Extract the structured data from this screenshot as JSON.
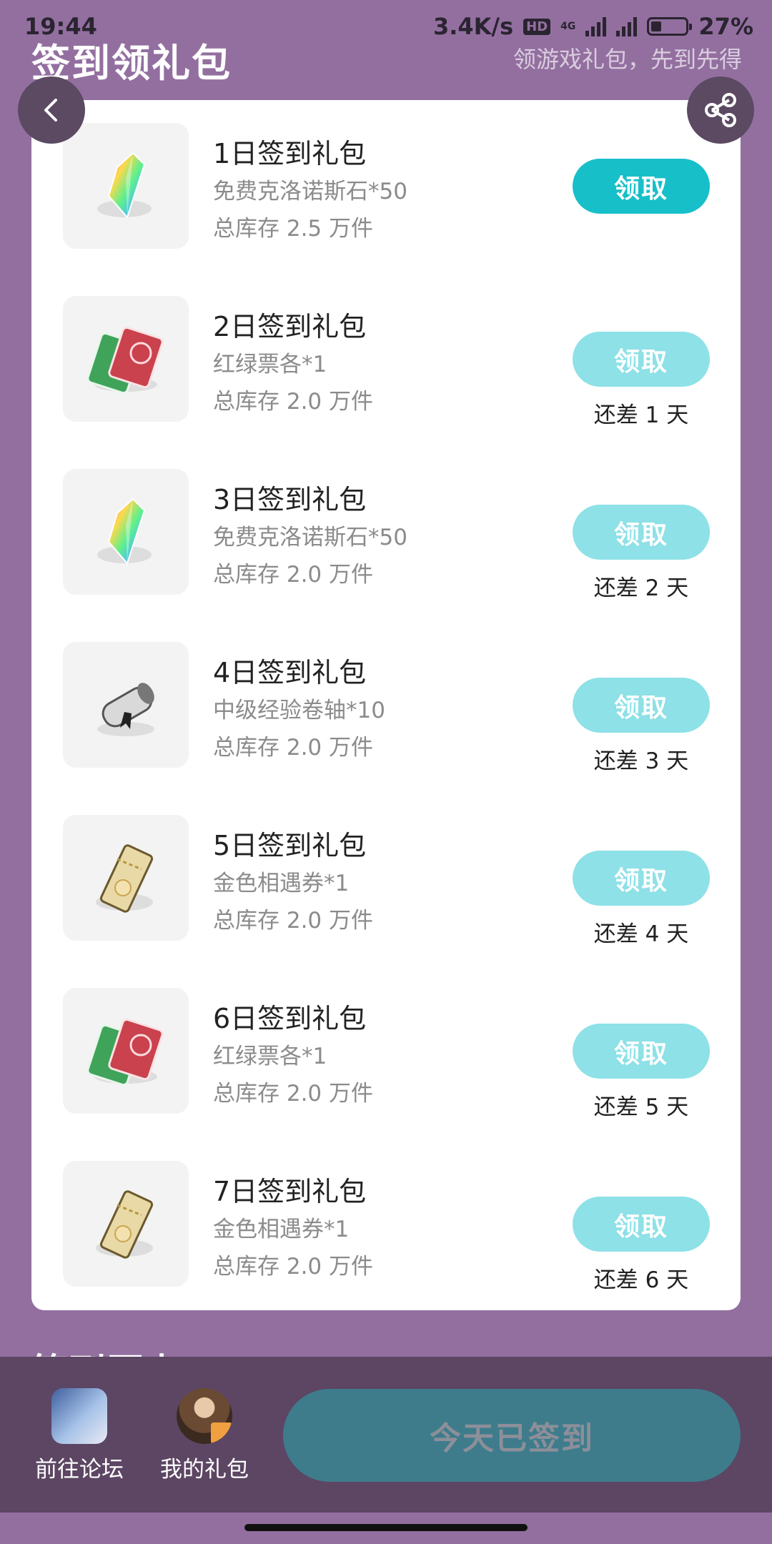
{
  "status_bar": {
    "time": "19:44",
    "net_speed": "3.4K/s",
    "hd": "HD",
    "network": "4G",
    "battery": "27%"
  },
  "header": {
    "title": "签到领礼包",
    "subtitle": "领游戏礼包，先到先得"
  },
  "gifts": [
    {
      "title": "1日签到礼包",
      "desc": "免费克洛诺斯石*50",
      "stock": "总库存 2.5 万件",
      "button": "领取",
      "claimable": true,
      "days_left": "",
      "icon": "rainbow-crystal-icon"
    },
    {
      "title": "2日签到礼包",
      "desc": "红绿票各*1",
      "stock": "总库存 2.0 万件",
      "button": "领取",
      "claimable": false,
      "days_left": "还差 1 天",
      "icon": "red-green-tickets-icon"
    },
    {
      "title": "3日签到礼包",
      "desc": "免费克洛诺斯石*50",
      "stock": "总库存 2.0 万件",
      "button": "领取",
      "claimable": false,
      "days_left": "还差 2 天",
      "icon": "rainbow-crystal-icon"
    },
    {
      "title": "4日签到礼包",
      "desc": "中级经验卷轴*10",
      "stock": "总库存 2.0 万件",
      "button": "领取",
      "claimable": false,
      "days_left": "还差 3 天",
      "icon": "scroll-icon"
    },
    {
      "title": "5日签到礼包",
      "desc": "金色相遇券*1",
      "stock": "总库存 2.0 万件",
      "button": "领取",
      "claimable": false,
      "days_left": "还差 4 天",
      "icon": "gold-ticket-icon"
    },
    {
      "title": "6日签到礼包",
      "desc": "红绿票各*1",
      "stock": "总库存 2.0 万件",
      "button": "领取",
      "claimable": false,
      "days_left": "还差 5 天",
      "icon": "red-green-tickets-icon"
    },
    {
      "title": "7日签到礼包",
      "desc": "金色相遇券*1",
      "stock": "总库存 2.0 万件",
      "button": "领取",
      "claimable": false,
      "days_left": "还差 6 天",
      "icon": "gold-ticket-icon"
    }
  ],
  "history_heading": "签到历史",
  "bottom_nav": {
    "forum_label": "前往论坛",
    "mygift_label": "我的礼包",
    "signed_label": "今天已签到"
  },
  "colors": {
    "background": "#936fa0",
    "accent_active": "#17bfc9",
    "accent_inactive": "#8de1e7",
    "bottom_bar": "#5c4663"
  }
}
